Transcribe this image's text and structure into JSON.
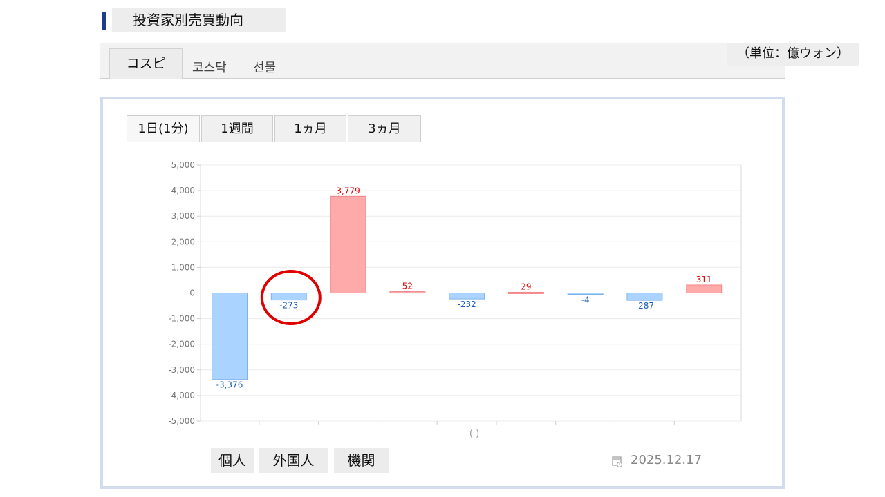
{
  "page": {
    "title": "投資家別売買動向",
    "unit": "（単位：億ウォン）"
  },
  "market_tabs": [
    {
      "label": "コスピ",
      "active": true
    },
    {
      "label": "코스닥",
      "active": false
    },
    {
      "label": "선물",
      "active": false
    }
  ],
  "period_tabs": [
    {
      "label": "1日(1分)",
      "active": true
    },
    {
      "label": "1週間",
      "active": false
    },
    {
      "label": "1ヵ月",
      "active": false
    },
    {
      "label": "3ヵ月",
      "active": false
    }
  ],
  "category_buttons": [
    {
      "label": "個人"
    },
    {
      "label": "外国人"
    },
    {
      "label": "機関"
    }
  ],
  "date": "2025.12.17",
  "icons": {
    "date": "calendar-clock-icon"
  },
  "colors": {
    "positive_fill": "#ffaaaa",
    "negative_fill": "#aad4ff",
    "positive_text": "#e00000",
    "negative_text": "#1a5fc0",
    "highlight": "#e00000"
  },
  "chart_data": {
    "type": "bar",
    "xlabel": "( )",
    "ylim": [
      -5000,
      5000
    ],
    "yticks": [
      "-5,000",
      "-4,000",
      "-3,000",
      "-2,000",
      "-1,000",
      "0",
      "1,000",
      "2,000",
      "3,000",
      "4,000",
      "5,000"
    ],
    "values": [
      -3376,
      -273,
      3779,
      52,
      -232,
      29,
      -4,
      -287,
      311
    ],
    "labels": [
      "-3,376",
      "-273",
      "3,779",
      "52",
      "-232",
      "29",
      "-4",
      "-287",
      "311"
    ],
    "highlighted_index": 1,
    "grid": true
  }
}
